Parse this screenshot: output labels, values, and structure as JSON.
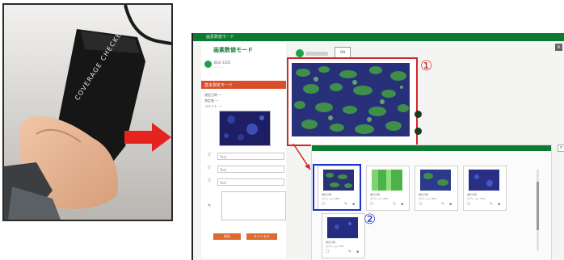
{
  "photo": {
    "device_label": "COVERAGE CHECKER"
  },
  "app": {
    "title": "画素数値モード",
    "user_name": "BGU-1201",
    "user_sub": "· · · · ·",
    "section_title": "基本測定モード",
    "fields": [
      "測定日時  ---",
      "測定者  ---",
      "コメント  ---"
    ],
    "form_inputs": [
      "Text",
      "Text",
      "Text"
    ],
    "memo": "",
    "buttons": [
      "保存",
      "キャンセル"
    ],
    "toggle_box": "ON"
  },
  "gallery": {
    "close_glyph": "×",
    "cards": [
      {
        "meta1": "撮影日時",
        "meta2": "カバレッジ 38%"
      },
      {
        "meta1": "撮影日時",
        "meta2": "カバレッジ 95%"
      },
      {
        "meta1": "撮影日時",
        "meta2": "カバレッジ 42%"
      },
      {
        "meta1": "撮影日時",
        "meta2": "カバレッジ 12%"
      },
      {
        "meta1": "撮影日時",
        "meta2": "カバレッジ 10%"
      }
    ]
  },
  "annotations": {
    "marker1": "①",
    "marker2": "②"
  },
  "colors": {
    "accent_green": "#0d7a33",
    "highlight_red": "#d4252c",
    "select_blue": "#1c33c8",
    "orange": "#de6a2e"
  }
}
